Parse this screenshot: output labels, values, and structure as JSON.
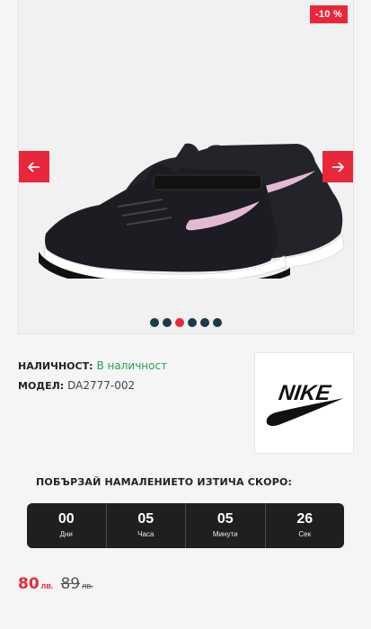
{
  "gallery": {
    "discount_badge": "-10 %",
    "dots_count": 6,
    "active_dot": 2,
    "colors": {
      "accent": "#e8283a",
      "dot": "#1b3a4b"
    },
    "prev_icon": "arrow-left-icon",
    "next_icon": "arrow-right-icon"
  },
  "product": {
    "availability_label": "НАЛИЧНОСТ:",
    "availability_value": "В наличност",
    "model_label": "МОДЕЛ:",
    "model_value": "DA2777-002",
    "brand_logo_text": "NIKE"
  },
  "promo": {
    "hurry_text": "ПОБЪРЗАЙ НАМАЛЕНИЕТО ИЗТИЧА СКОРО:"
  },
  "countdown": [
    {
      "value": "00",
      "label": "Дни"
    },
    {
      "value": "05",
      "label": "Часа"
    },
    {
      "value": "05",
      "label": "Минути"
    },
    {
      "value": "26",
      "label": "Сек"
    }
  ],
  "price": {
    "new_value": "80",
    "new_currency": "лв.",
    "old_value": "89",
    "old_currency": "лв."
  }
}
